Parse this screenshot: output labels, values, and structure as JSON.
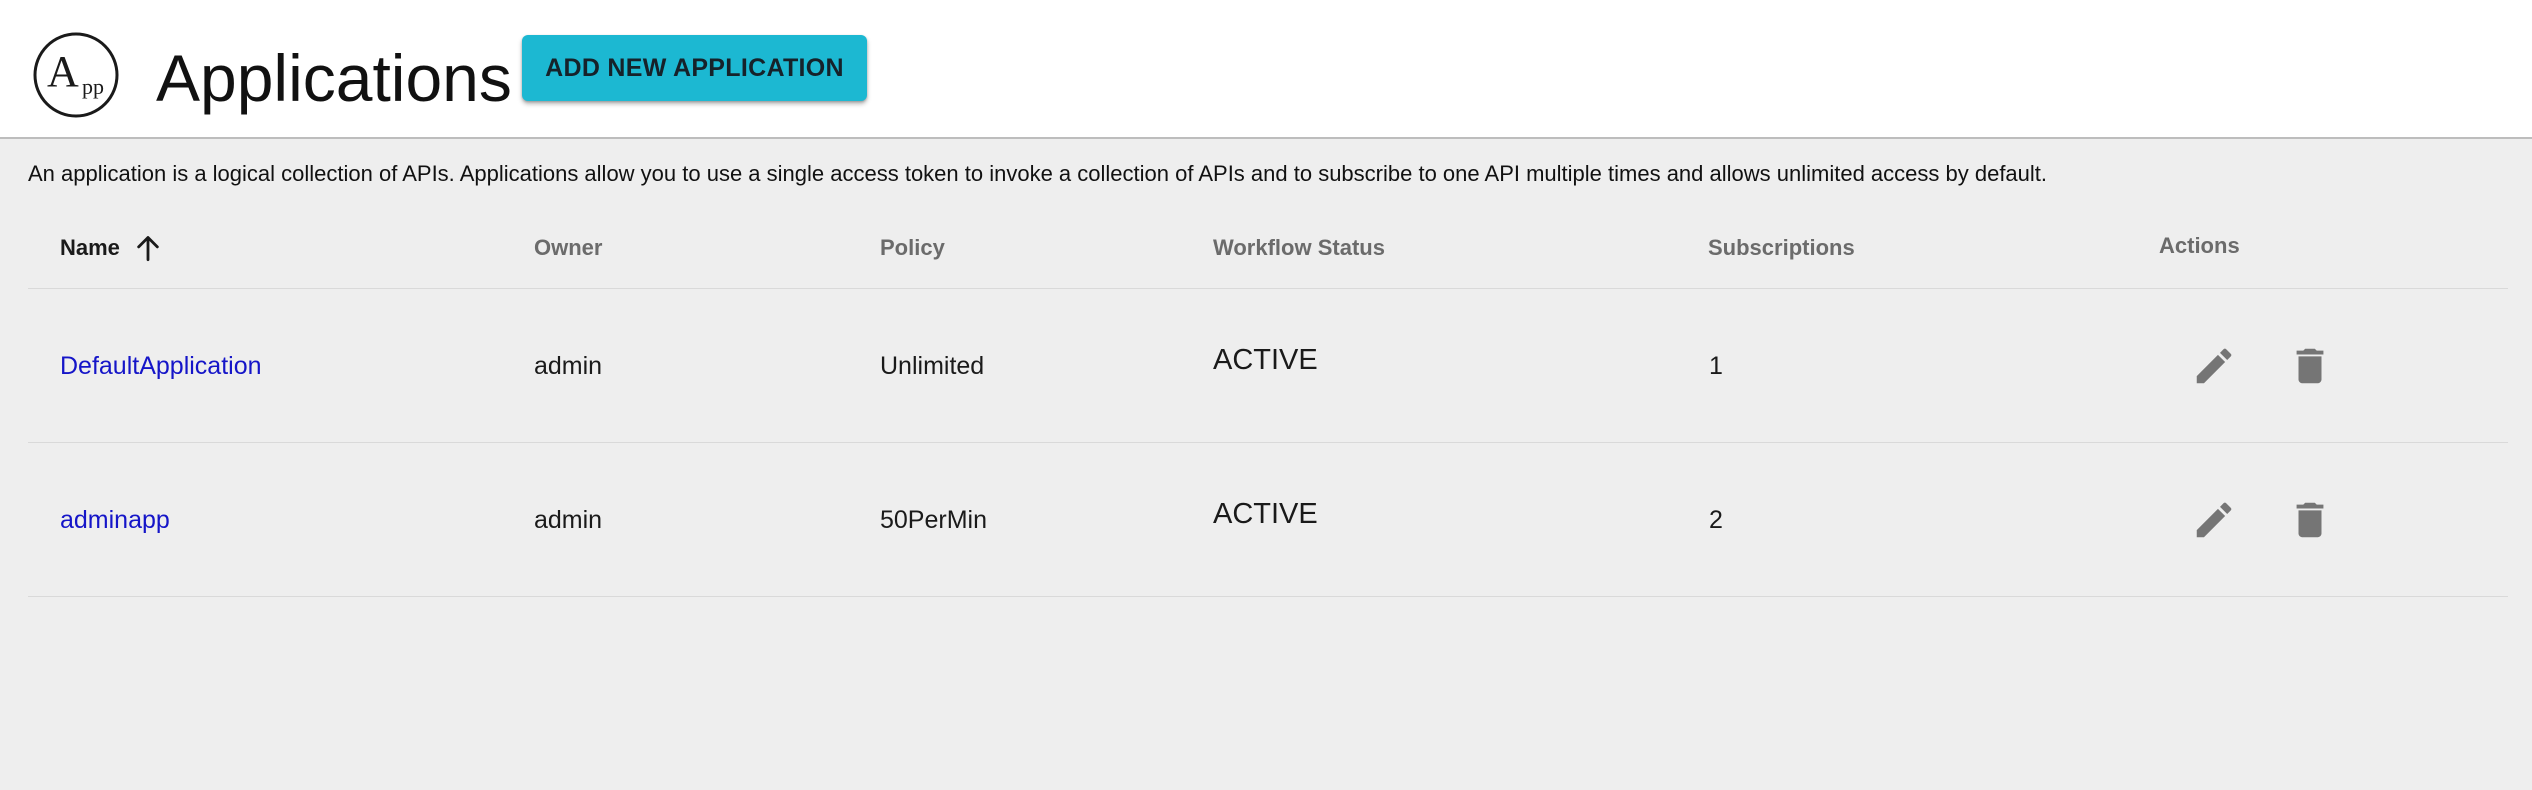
{
  "header": {
    "logo_text": "App",
    "title": "Applications",
    "add_button_label": "ADD NEW APPLICATION"
  },
  "description": "An application is a logical collection of APIs. Applications allow you to use a single access token to invoke a collection of APIs and to subscribe to one API multiple times and allows unlimited access by default.",
  "table": {
    "columns": {
      "name": "Name",
      "owner": "Owner",
      "policy": "Policy",
      "workflow_status": "Workflow Status",
      "subscriptions": "Subscriptions",
      "actions": "Actions"
    },
    "sort": {
      "column": "Name",
      "direction": "ascending",
      "icon": "arrow-up-icon"
    },
    "rows": [
      {
        "name": "DefaultApplication",
        "owner": "admin",
        "policy": "Unlimited",
        "workflow_status": "ACTIVE",
        "subscriptions": "1"
      },
      {
        "name": "adminapp",
        "owner": "admin",
        "policy": "50PerMin",
        "workflow_status": "ACTIVE",
        "subscriptions": "2"
      }
    ],
    "action_icons": [
      "edit-icon",
      "delete-icon"
    ]
  },
  "colors": {
    "accent_button": "#1cb8d2",
    "link": "#1515c8",
    "background": "#eeeeee",
    "icon": "#757575"
  }
}
